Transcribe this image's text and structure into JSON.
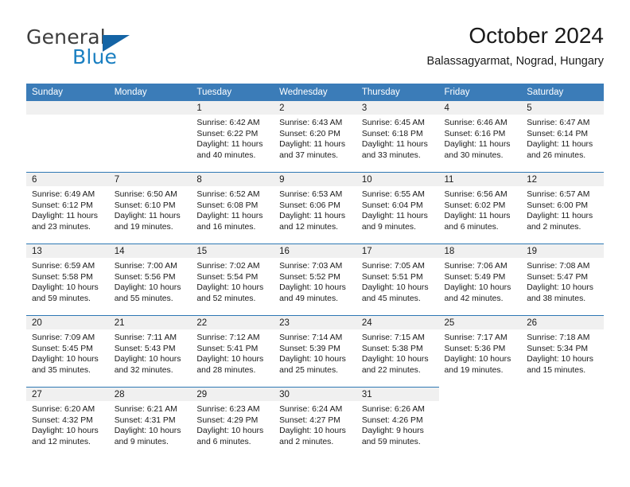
{
  "brand": {
    "name_top": "General",
    "name_bottom": "Blue",
    "color_dark": "#3d3d3d",
    "color_blue": "#1a7fc1",
    "triangle_color": "#1464a5"
  },
  "header": {
    "title": "October 2024",
    "subtitle": "Balassagyarmat, Nograd, Hungary"
  },
  "theme": {
    "header_row_bg": "#3b7cb8",
    "daynum_band_bg": "#f0f0f0",
    "row_divider": "#2e78b4",
    "text": "#1a1a1a"
  },
  "labels": {
    "sunrise": "Sunrise:",
    "sunset": "Sunset:",
    "daylight": "Daylight:"
  },
  "weekdays": [
    "Sunday",
    "Monday",
    "Tuesday",
    "Wednesday",
    "Thursday",
    "Friday",
    "Saturday"
  ],
  "weeks": [
    [
      {
        "empty": true
      },
      {
        "empty": true
      },
      {
        "day": "1",
        "sunrise": "Sunrise: 6:42 AM",
        "sunset": "Sunset: 6:22 PM",
        "daylight_1": "Daylight: 11 hours",
        "daylight_2": "and 40 minutes."
      },
      {
        "day": "2",
        "sunrise": "Sunrise: 6:43 AM",
        "sunset": "Sunset: 6:20 PM",
        "daylight_1": "Daylight: 11 hours",
        "daylight_2": "and 37 minutes."
      },
      {
        "day": "3",
        "sunrise": "Sunrise: 6:45 AM",
        "sunset": "Sunset: 6:18 PM",
        "daylight_1": "Daylight: 11 hours",
        "daylight_2": "and 33 minutes."
      },
      {
        "day": "4",
        "sunrise": "Sunrise: 6:46 AM",
        "sunset": "Sunset: 6:16 PM",
        "daylight_1": "Daylight: 11 hours",
        "daylight_2": "and 30 minutes."
      },
      {
        "day": "5",
        "sunrise": "Sunrise: 6:47 AM",
        "sunset": "Sunset: 6:14 PM",
        "daylight_1": "Daylight: 11 hours",
        "daylight_2": "and 26 minutes."
      }
    ],
    [
      {
        "day": "6",
        "sunrise": "Sunrise: 6:49 AM",
        "sunset": "Sunset: 6:12 PM",
        "daylight_1": "Daylight: 11 hours",
        "daylight_2": "and 23 minutes."
      },
      {
        "day": "7",
        "sunrise": "Sunrise: 6:50 AM",
        "sunset": "Sunset: 6:10 PM",
        "daylight_1": "Daylight: 11 hours",
        "daylight_2": "and 19 minutes."
      },
      {
        "day": "8",
        "sunrise": "Sunrise: 6:52 AM",
        "sunset": "Sunset: 6:08 PM",
        "daylight_1": "Daylight: 11 hours",
        "daylight_2": "and 16 minutes."
      },
      {
        "day": "9",
        "sunrise": "Sunrise: 6:53 AM",
        "sunset": "Sunset: 6:06 PM",
        "daylight_1": "Daylight: 11 hours",
        "daylight_2": "and 12 minutes."
      },
      {
        "day": "10",
        "sunrise": "Sunrise: 6:55 AM",
        "sunset": "Sunset: 6:04 PM",
        "daylight_1": "Daylight: 11 hours",
        "daylight_2": "and 9 minutes."
      },
      {
        "day": "11",
        "sunrise": "Sunrise: 6:56 AM",
        "sunset": "Sunset: 6:02 PM",
        "daylight_1": "Daylight: 11 hours",
        "daylight_2": "and 6 minutes."
      },
      {
        "day": "12",
        "sunrise": "Sunrise: 6:57 AM",
        "sunset": "Sunset: 6:00 PM",
        "daylight_1": "Daylight: 11 hours",
        "daylight_2": "and 2 minutes."
      }
    ],
    [
      {
        "day": "13",
        "sunrise": "Sunrise: 6:59 AM",
        "sunset": "Sunset: 5:58 PM",
        "daylight_1": "Daylight: 10 hours",
        "daylight_2": "and 59 minutes."
      },
      {
        "day": "14",
        "sunrise": "Sunrise: 7:00 AM",
        "sunset": "Sunset: 5:56 PM",
        "daylight_1": "Daylight: 10 hours",
        "daylight_2": "and 55 minutes."
      },
      {
        "day": "15",
        "sunrise": "Sunrise: 7:02 AM",
        "sunset": "Sunset: 5:54 PM",
        "daylight_1": "Daylight: 10 hours",
        "daylight_2": "and 52 minutes."
      },
      {
        "day": "16",
        "sunrise": "Sunrise: 7:03 AM",
        "sunset": "Sunset: 5:52 PM",
        "daylight_1": "Daylight: 10 hours",
        "daylight_2": "and 49 minutes."
      },
      {
        "day": "17",
        "sunrise": "Sunrise: 7:05 AM",
        "sunset": "Sunset: 5:51 PM",
        "daylight_1": "Daylight: 10 hours",
        "daylight_2": "and 45 minutes."
      },
      {
        "day": "18",
        "sunrise": "Sunrise: 7:06 AM",
        "sunset": "Sunset: 5:49 PM",
        "daylight_1": "Daylight: 10 hours",
        "daylight_2": "and 42 minutes."
      },
      {
        "day": "19",
        "sunrise": "Sunrise: 7:08 AM",
        "sunset": "Sunset: 5:47 PM",
        "daylight_1": "Daylight: 10 hours",
        "daylight_2": "and 38 minutes."
      }
    ],
    [
      {
        "day": "20",
        "sunrise": "Sunrise: 7:09 AM",
        "sunset": "Sunset: 5:45 PM",
        "daylight_1": "Daylight: 10 hours",
        "daylight_2": "and 35 minutes."
      },
      {
        "day": "21",
        "sunrise": "Sunrise: 7:11 AM",
        "sunset": "Sunset: 5:43 PM",
        "daylight_1": "Daylight: 10 hours",
        "daylight_2": "and 32 minutes."
      },
      {
        "day": "22",
        "sunrise": "Sunrise: 7:12 AM",
        "sunset": "Sunset: 5:41 PM",
        "daylight_1": "Daylight: 10 hours",
        "daylight_2": "and 28 minutes."
      },
      {
        "day": "23",
        "sunrise": "Sunrise: 7:14 AM",
        "sunset": "Sunset: 5:39 PM",
        "daylight_1": "Daylight: 10 hours",
        "daylight_2": "and 25 minutes."
      },
      {
        "day": "24",
        "sunrise": "Sunrise: 7:15 AM",
        "sunset": "Sunset: 5:38 PM",
        "daylight_1": "Daylight: 10 hours",
        "daylight_2": "and 22 minutes."
      },
      {
        "day": "25",
        "sunrise": "Sunrise: 7:17 AM",
        "sunset": "Sunset: 5:36 PM",
        "daylight_1": "Daylight: 10 hours",
        "daylight_2": "and 19 minutes."
      },
      {
        "day": "26",
        "sunrise": "Sunrise: 7:18 AM",
        "sunset": "Sunset: 5:34 PM",
        "daylight_1": "Daylight: 10 hours",
        "daylight_2": "and 15 minutes."
      }
    ],
    [
      {
        "day": "27",
        "sunrise": "Sunrise: 6:20 AM",
        "sunset": "Sunset: 4:32 PM",
        "daylight_1": "Daylight: 10 hours",
        "daylight_2": "and 12 minutes."
      },
      {
        "day": "28",
        "sunrise": "Sunrise: 6:21 AM",
        "sunset": "Sunset: 4:31 PM",
        "daylight_1": "Daylight: 10 hours",
        "daylight_2": "and 9 minutes."
      },
      {
        "day": "29",
        "sunrise": "Sunrise: 6:23 AM",
        "sunset": "Sunset: 4:29 PM",
        "daylight_1": "Daylight: 10 hours",
        "daylight_2": "and 6 minutes."
      },
      {
        "day": "30",
        "sunrise": "Sunrise: 6:24 AM",
        "sunset": "Sunset: 4:27 PM",
        "daylight_1": "Daylight: 10 hours",
        "daylight_2": "and 2 minutes."
      },
      {
        "day": "31",
        "sunrise": "Sunrise: 6:26 AM",
        "sunset": "Sunset: 4:26 PM",
        "daylight_1": "Daylight: 9 hours",
        "daylight_2": "and 59 minutes."
      },
      {
        "empty": true
      },
      {
        "empty": true
      }
    ]
  ]
}
